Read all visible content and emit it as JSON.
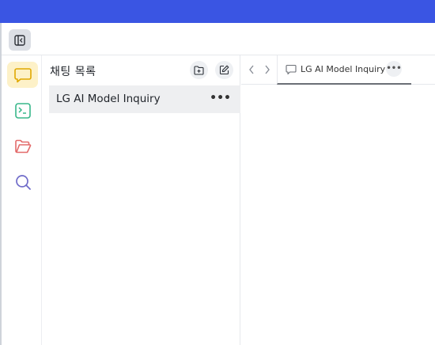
{
  "toolbar": {
    "sidebar_toggle_icon": "sidebar-collapse-icon"
  },
  "rail": {
    "items": [
      {
        "name": "chat",
        "icon": "chat-bubble-icon",
        "color": "#e0a800",
        "active": true
      },
      {
        "name": "terminal",
        "icon": "terminal-icon",
        "color": "#38b78a",
        "active": false
      },
      {
        "name": "folder",
        "icon": "folder-icon",
        "color": "#e36b6b",
        "active": false
      },
      {
        "name": "search",
        "icon": "search-icon",
        "color": "#6f6bc9",
        "active": false
      }
    ]
  },
  "chat_list": {
    "title": "채팅 목록",
    "new_folder_icon": "new-folder-icon",
    "new_chat_icon": "edit-icon",
    "items": [
      {
        "label": "LG AI Model Inquiry",
        "more": "•••"
      }
    ]
  },
  "tabs": {
    "back_icon": "chevron-left-icon",
    "forward_icon": "chevron-right-icon",
    "items": [
      {
        "label": "LG AI Model Inquiry",
        "more": "•••",
        "icon": "chat-bubble-icon"
      }
    ]
  },
  "colors": {
    "title_bar": "#3a55e3",
    "active_rail_bg": "#fdf1c8",
    "selected_item_bg": "#eeeff1"
  }
}
